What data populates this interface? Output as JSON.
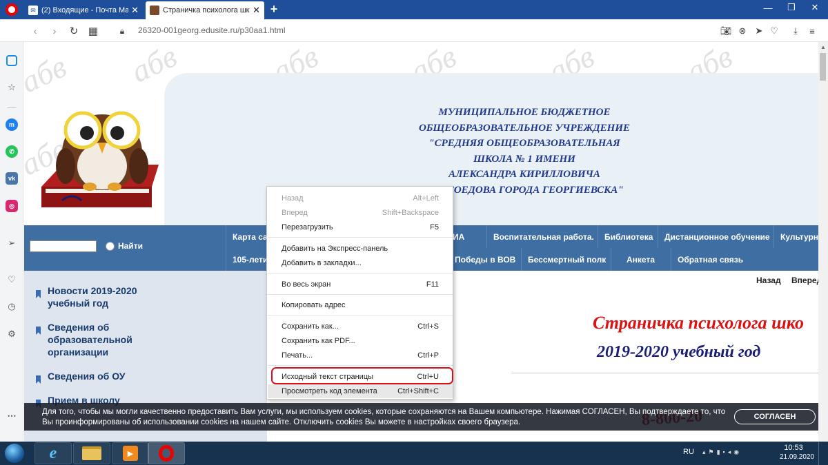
{
  "browser": {
    "tabs": [
      {
        "title": "(2) Входящие - Почта Mai",
        "icon": "mail-icon"
      },
      {
        "title": "Страничка психолога шко",
        "icon": "site-favicon-icon"
      }
    ],
    "new_tab": "+",
    "url_host": "26320-001georg.edusite.ru",
    "url_path": "/p30aa1.html"
  },
  "site": {
    "watermark": "абв",
    "school_name": "МУНИЦИПАЛЬНОЕ БЮДЖЕТНОЕ\nОБЩЕОБРАЗОВАТЕЛЬНОЕ УЧРЕЖДЕНИЕ\n\"СРЕДНЯЯ ОБЩЕОБРАЗОВАТЕЛЬНАЯ\nШКОЛА № 1 ИМЕНИ\nАЛЕКСАНДРА КИРИЛЛОВИЧА\nПРОСОЕДОВА ГОРОДА ГЕОРГИЕВСКА\"",
    "search_label": "Найти",
    "nav_row1": [
      "Карта са",
      "ИА",
      "Воспитательная работа.",
      "Библиотека",
      "Дистанционное обучение",
      "Культурн"
    ],
    "nav_row2": [
      "105-летие",
      "Победы в ВОВ",
      "Бессмертный полк",
      "Анкета",
      "Обратная связь"
    ],
    "left_menu": [
      "Новости 2019-2020\nучебный год",
      "Сведения об\nобразовательной\nорганизации",
      "Сведения об ОУ",
      "Прием в школу"
    ],
    "prev": "Назад",
    "next": "Вперед",
    "page_title": "Страничка психолога шко",
    "page_year": "2019-2020 учебный год",
    "phone_fragment": "8-800-20"
  },
  "context_menu": {
    "items": [
      {
        "label": "Назад",
        "shortcut": "Alt+Left",
        "disabled": true
      },
      {
        "label": "Вперед",
        "shortcut": "Shift+Backspace",
        "disabled": true
      },
      {
        "label": "Перезагрузить",
        "shortcut": "F5"
      },
      {
        "label": "Добавить на Экспресс-панель",
        "shortcut": ""
      },
      {
        "label": "Добавить в закладки...",
        "shortcut": ""
      },
      {
        "label": "Во весь экран",
        "shortcut": "F11"
      },
      {
        "label": "Копировать адрес",
        "shortcut": ""
      },
      {
        "label": "Сохранить как...",
        "shortcut": "Ctrl+S"
      },
      {
        "label": "Сохранить как PDF...",
        "shortcut": ""
      },
      {
        "label": "Печать...",
        "shortcut": "Ctrl+P"
      },
      {
        "label": "Исходный текст страницы",
        "shortcut": "Ctrl+U",
        "highlighted": true
      },
      {
        "label": "Просмотреть код элемента",
        "shortcut": "Ctrl+Shift+C"
      }
    ]
  },
  "cookie_banner": {
    "text": "Для того, чтобы мы могли качественно предоставить Вам услуги, мы используем cookies, которые сохраняются на Вашем компьютере. Нажимая СОГЛАСЕН, Вы подтверждаете то, что Вы проинформированы об использовании cookies на нашем сайте. Отключить cookies Вы можете в настройках своего браузера.",
    "button": "СОГЛАСЕН"
  },
  "taskbar": {
    "lang": "RU",
    "time": "10:53",
    "date": "21.09.2020"
  },
  "colors": {
    "opera_red": "#e00000",
    "nav_blue": "#3f6ea3",
    "title_red": "#dd1111",
    "school_blue": "#213a8c",
    "highlight_red": "#d8101a"
  }
}
